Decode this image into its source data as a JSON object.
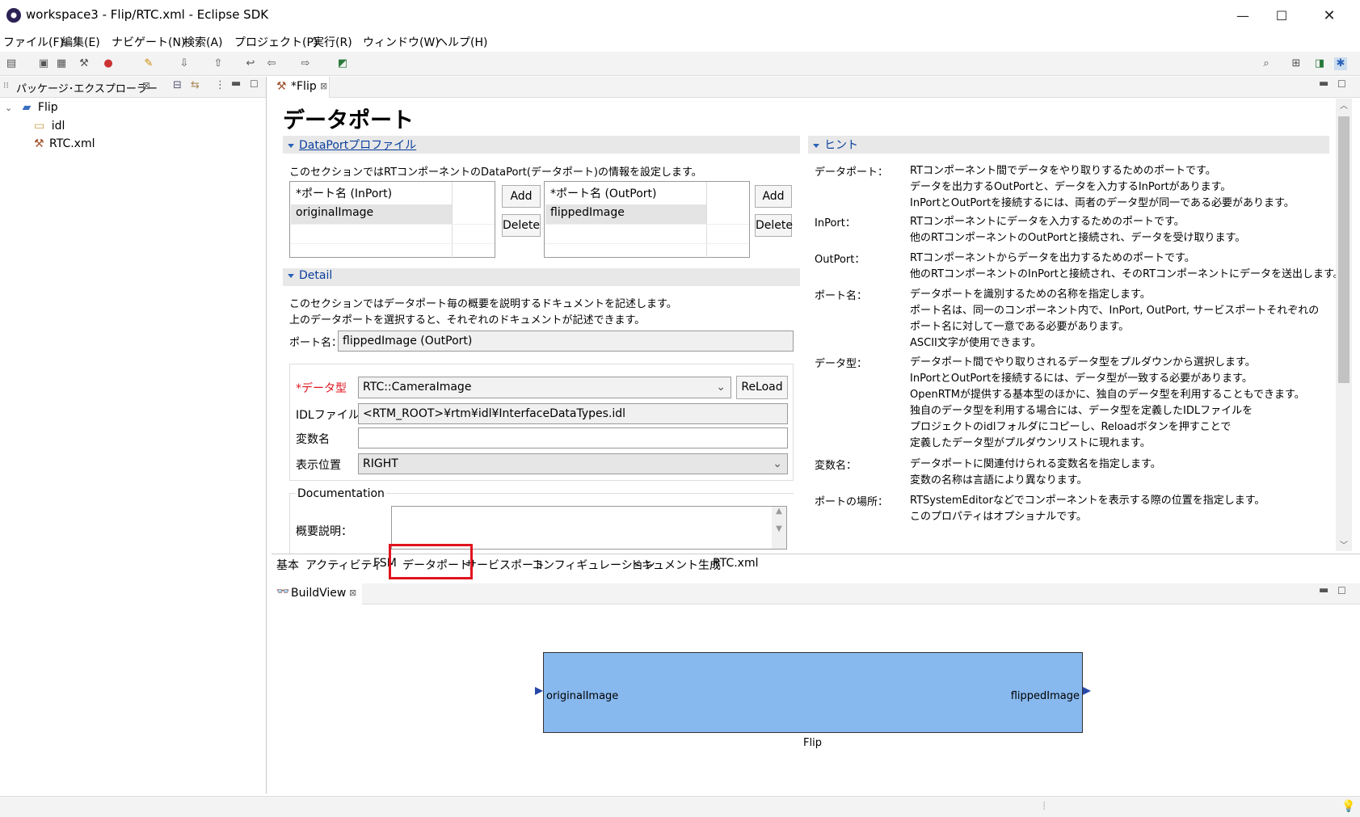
{
  "window": {
    "title": "workspace3 - Flip/RTC.xml - Eclipse SDK",
    "minimize": "—",
    "maximize": "☐",
    "close": "✕"
  },
  "menu": [
    "ファイル(F)",
    "編集(E)",
    "ナビゲート(N)",
    "検索(A)",
    "プロジェクト(P)",
    "実行(R)",
    "ウィンドウ(W)",
    "ヘルプ(H)"
  ],
  "package_explorer": {
    "tab_label": "パッケージ･エクスプローラー",
    "tree": [
      {
        "label": "Flip",
        "icon": "project-folder-icon"
      },
      {
        "label": "idl",
        "icon": "folder-icon"
      },
      {
        "label": "RTC.xml",
        "icon": "rtc-xml-icon"
      }
    ]
  },
  "editor": {
    "tab_label": "*Flip",
    "page_title": "データポート",
    "profile_section": "DataPortプロファイル",
    "profile_desc": "このセクションではRTコンポーネントのDataPort(データポート)の情報を設定します。",
    "inport_header": "*ポート名 (InPort)",
    "inport_row": "originalImage",
    "outport_header": "*ポート名 (OutPort)",
    "outport_row": "flippedImage",
    "add_label": "Add",
    "delete_label": "Delete",
    "detail_section": "Detail",
    "detail_desc1": "このセクションではデータポート毎の概要を説明するドキュメントを記述します。",
    "detail_desc2": "上のデータポートを選択すると、それぞれのドキュメントが記述できます。",
    "port_name_label": "ポート名：",
    "port_name_value": "flippedImage (OutPort)",
    "datatype_label": "*データ型",
    "datatype_value": "RTC::CameraImage",
    "reload_label": "ReLoad",
    "idl_label": "IDLファイル：",
    "idl_value": "<RTM_ROOT>¥rtm¥idl¥InterfaceDataTypes.idl",
    "var_label": "変数名",
    "var_value": "",
    "position_label": "表示位置",
    "position_value": "RIGHT",
    "documentation_label": "Documentation",
    "summary_label": "概要説明："
  },
  "hint": {
    "section": "ヒント",
    "items": [
      {
        "key": "データポート：",
        "lines": [
          "RTコンポーネント間でデータをやり取りするためのポートです。",
          "データを出力するOutPortと、データを入力するInPortがあります。",
          "InPortとOutPortを接続するには、両者のデータ型が同一である必要があります。"
        ]
      },
      {
        "key": "InPort：",
        "lines": [
          "RTコンポーネントにデータを入力するためのポートです。",
          "他のRTコンポーネントのOutPortと接続され、データを受け取ります。"
        ]
      },
      {
        "key": "OutPort：",
        "lines": [
          "RTコンポーネントからデータを出力するためのポートです。",
          "他のRTコンポーネントのInPortと接続され、そのRTコンポーネントにデータを送出します。"
        ]
      },
      {
        "key": "ポート名：",
        "lines": [
          "データポートを識別するための名称を指定します。",
          "ポート名は、同一のコンポーネント内で、InPort, OutPort, サービスポートそれぞれの",
          "ポート名に対して一意である必要があります。",
          "ASCII文字が使用できます。"
        ]
      },
      {
        "key": "データ型：",
        "lines": [
          "データポート間でやり取りされるデータ型をプルダウンから選択します。",
          "InPortとOutPortを接続するには、データ型が一致する必要があります。",
          "OpenRTMが提供する基本型のほかに、独自のデータ型を利用することもできます。",
          "独自のデータ型を利用する場合には、データ型を定義したIDLファイルを",
          "プロジェクトのidlフォルダにコピーし、Reloadボタンを押すことで",
          "定義したデータ型がプルダウンリストに現れます。"
        ]
      },
      {
        "key": "変数名：",
        "lines": [
          "データポートに関連付けられる変数名を指定します。",
          "変数の名称は言語により異なります。"
        ]
      },
      {
        "key": "ポートの場所：",
        "lines": [
          "RTSystemEditorなどでコンポーネントを表示する際の位置を指定します。",
          "このプロパティはオプショナルです。"
        ]
      }
    ]
  },
  "editor_tabs": [
    "基本",
    "アクティビティ",
    "FSM",
    "データポート",
    "サービスポート",
    "コンフィギュレーション",
    "ドキュメント生成",
    "RTC.xml"
  ],
  "buildview": {
    "tab_label": "BuildView",
    "component_name": "Flip",
    "inport": "originalImage",
    "outport": "flippedImage"
  },
  "colors": {
    "component_fill": "#87b8ee",
    "highlight": "#e0141e",
    "section_title": "#0a3e9c"
  }
}
